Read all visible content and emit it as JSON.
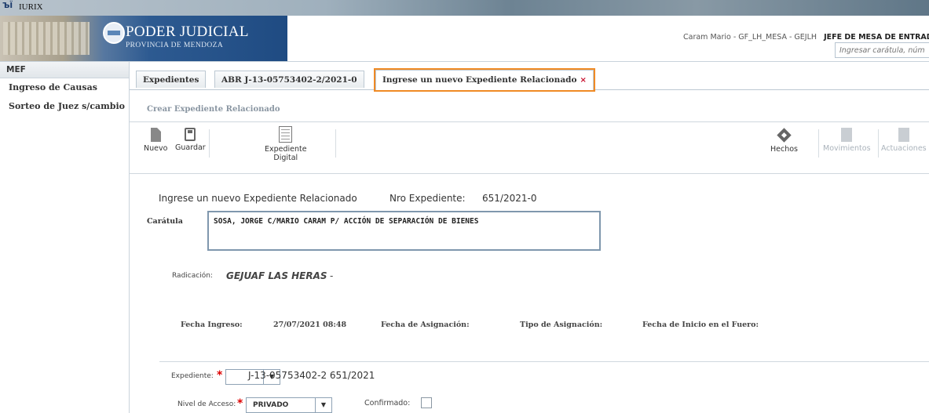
{
  "window": {
    "title": "IURIX"
  },
  "header": {
    "logo_main": "PODER JUDICIAL",
    "logo_sub": "PROVINCIA DE MENDOZA",
    "user": "Caram Mario - GF_LH_MESA - GEJLH",
    "role": "JEFE DE MESA DE ENTRADAS",
    "search_placeholder": "Ingresar carátula, núm"
  },
  "sidebar": {
    "header": "MEF",
    "items": [
      {
        "label": "Ingreso de Causas"
      },
      {
        "label": "Sorteo de Juez s/cambio"
      }
    ]
  },
  "tabs": [
    {
      "label": "Expedientes"
    },
    {
      "label": "ABR J-13-05753402-2/2021-0"
    },
    {
      "label": "Ingrese un nuevo Expediente Relacionado",
      "close": "×",
      "active": true
    }
  ],
  "section_title": "Crear Expediente Relacionado",
  "toolbar": {
    "nuevo": "Nuevo",
    "guardar": "Guardar",
    "expediente_digital_1": "Expediente",
    "expediente_digital_2": "Digital",
    "hechos": "Hechos",
    "movimientos": "Movimientos",
    "actuaciones": "Actuaciones"
  },
  "form": {
    "title": "Ingrese un nuevo Expediente Relacionado",
    "nro_label": "Nro Expediente:",
    "nro_value": "651/2021-0",
    "caratula_label": "Carátula",
    "caratula_value": "SOSA, JORGE C/MARIO CARAM  P/ ACCIÓN DE SEPARACIÓN DE BIENES",
    "radicacion_label": "Radicación:",
    "radicacion_value": "GEJUAF LAS HERAS",
    "radicacion_suffix": "-",
    "fecha_ingreso_label": "Fecha Ingreso:",
    "fecha_ingreso_value": "27/07/2021 08:48",
    "fecha_asignacion_label": "Fecha de Asignación:",
    "tipo_asignacion_label": "Tipo de Asignación:",
    "fecha_inicio_label": "Fecha de Inicio en el Fuero:",
    "expediente_label": "Expediente:",
    "required_mark": "*",
    "expediente_select_value": "",
    "expediente_value": "J-13-05753402-2 651/2021",
    "nivel_acceso_label": "Nivel de Acceso:",
    "nivel_acceso_value": "PRIVADO",
    "confirmado_label": "Confirmado:",
    "select_arrow": "▼"
  },
  "colors": {
    "accent_tab_outline": "#f08a24",
    "required": "#dd0000",
    "close_icon": "#c8102e"
  }
}
